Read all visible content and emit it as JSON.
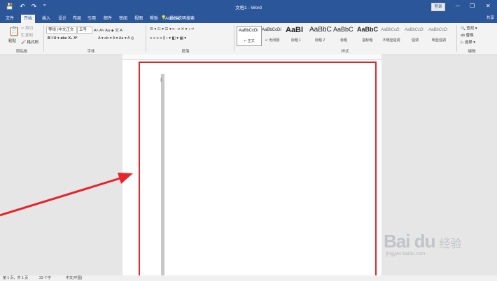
{
  "window": {
    "title": "文档1 - Word",
    "signin": "登录",
    "minimize": "─",
    "restore": "❐",
    "close": "✕",
    "user": "共享"
  },
  "qat": {
    "save": "💾",
    "undo": "↶",
    "redo": "↷",
    "more": "⁼"
  },
  "tabs": [
    "文件",
    "开始",
    "插入",
    "设计",
    "布局",
    "引用",
    "邮件",
    "审阅",
    "视图",
    "帮助",
    "Acrobat"
  ],
  "active_tab": "开始",
  "tellme": {
    "icon": "💡",
    "label": "操作说明搜索"
  },
  "clipboard": {
    "paste": "粘贴",
    "cut": "✂ 剪切",
    "copy": "⎘ 复制",
    "painter": "🖌 格式刷",
    "group": "剪贴板"
  },
  "font": {
    "name": "等线 (中文正文",
    "size": "五号",
    "group": "字体",
    "row1_icons": "A˄ A˅ Aa ◈ 文 A",
    "row2_icons": "B I U ▾ abc X₂ X²",
    "row3_icons": "A ▾ ab ▾ A ▾ Aa ▾ A ◎"
  },
  "paragraph": {
    "group": "段落",
    "row1_icons": "☰ ▾ ☷ ▾ ☲ ▾ ⇤ ⇥ ✕ ▾ ↕ ↵",
    "row2_icons": "≡ ≡ ≡ ≡ ⫼ ↕ ▾ ◧ ▾ ▦ ▾"
  },
  "styles": {
    "group": "样式",
    "items": [
      {
        "sample": "AaBbCcDi",
        "label": "↵ 正文"
      },
      {
        "sample": "AaBbCcDi",
        "label": "↵ 无间隔"
      },
      {
        "sample": "AaBl",
        "label": "标题 1"
      },
      {
        "sample": "AaBbC",
        "label": "标题 2"
      },
      {
        "sample": "AaBbC",
        "label": "标题"
      },
      {
        "sample": "AaBbC",
        "label": "副标题"
      },
      {
        "sample": "AaBbCcD:",
        "label": "不明显强调"
      },
      {
        "sample": "AaBbCcD:",
        "label": "强调"
      },
      {
        "sample": "AaBbCcD:",
        "label": "明显强调"
      }
    ]
  },
  "editing": {
    "find": "🔍 查找 ▾",
    "replace": "ab 替换",
    "select": "▷ 选择 ▾",
    "group": "编辑"
  },
  "statusbar": {
    "page": "第 1 页，共 1 页",
    "words": "33 个字",
    "lang": "中文(中国)"
  },
  "watermark": {
    "logo": "Bai du",
    "cn": "经验",
    "url": "jingyan.baidu.com"
  },
  "colors": {
    "accent": "#2b579a",
    "highlight": "#e8232a"
  }
}
